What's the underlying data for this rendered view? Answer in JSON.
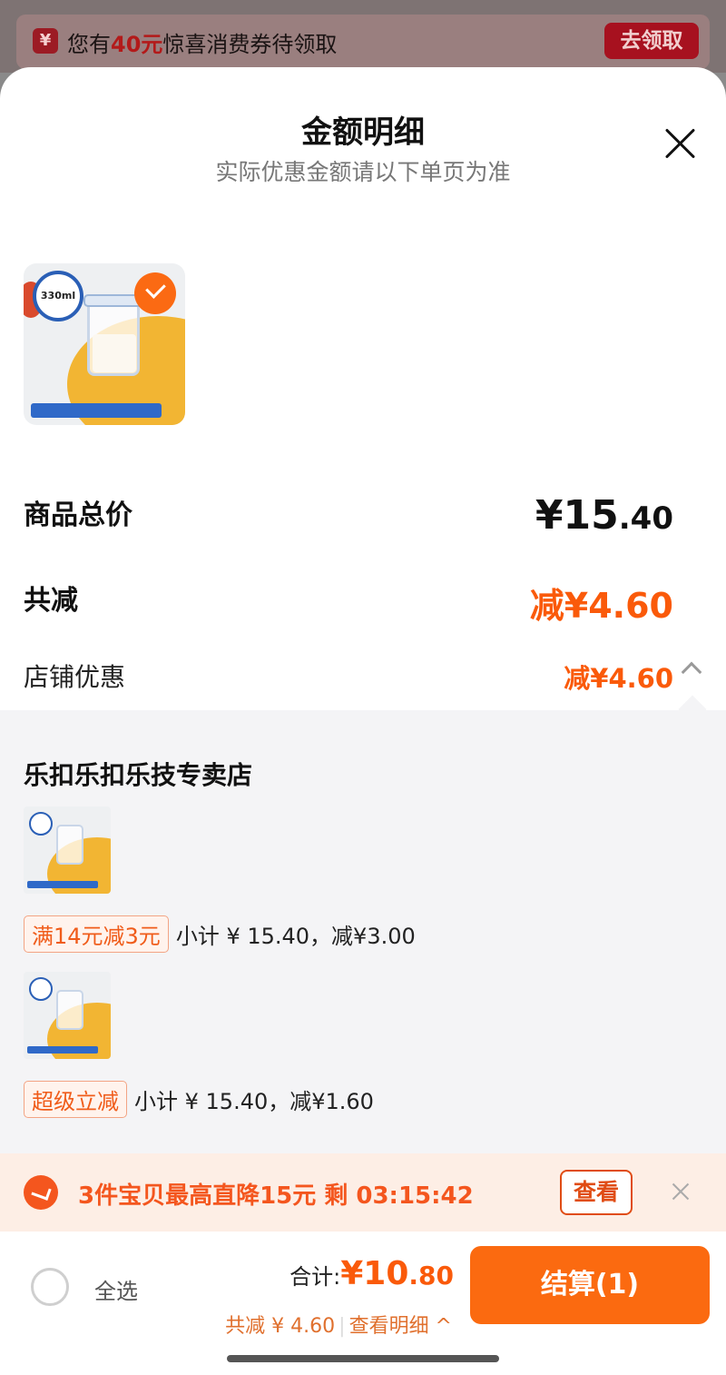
{
  "banner": {
    "prefix": "您有",
    "amount": "40元",
    "suffix": "惊喜消费券待领取",
    "button": "去领取"
  },
  "sheet": {
    "title": "金额明细",
    "subtitle": "实际优惠金额请以下单页为准"
  },
  "summary": {
    "total_label": "商品总价",
    "total_main": "¥15",
    "total_decimal": ".40",
    "reduce_label": "共减",
    "reduce_value": "减¥4.60",
    "shop_discount_label": "店铺优惠",
    "shop_discount_value": "减¥4.60"
  },
  "store": {
    "name": "乐扣乐扣乐技专卖店",
    "promos": [
      {
        "tag": "满14元减3元",
        "text": "小计 ¥ 15.40，减¥3.00"
      },
      {
        "tag": "超级立减",
        "text": "小计 ¥ 15.40，减¥1.60"
      }
    ]
  },
  "product_image": {
    "badge": "330ml"
  },
  "flash": {
    "text": "3件宝贝最高直降15元 剩 03:15:42",
    "button": "查看"
  },
  "bottom": {
    "select_all": "全选",
    "sum_label": "合计:",
    "sum_main": "¥10",
    "sum_decimal": ".80",
    "saving_text": "共减 ¥ 4.60",
    "view_detail": "查看明细 ^",
    "checkout": "结算(1)"
  },
  "colors": {
    "accent": "#fa5a0a",
    "checkout_bg": "#fb6a10",
    "banner_btn": "#a7111f"
  }
}
